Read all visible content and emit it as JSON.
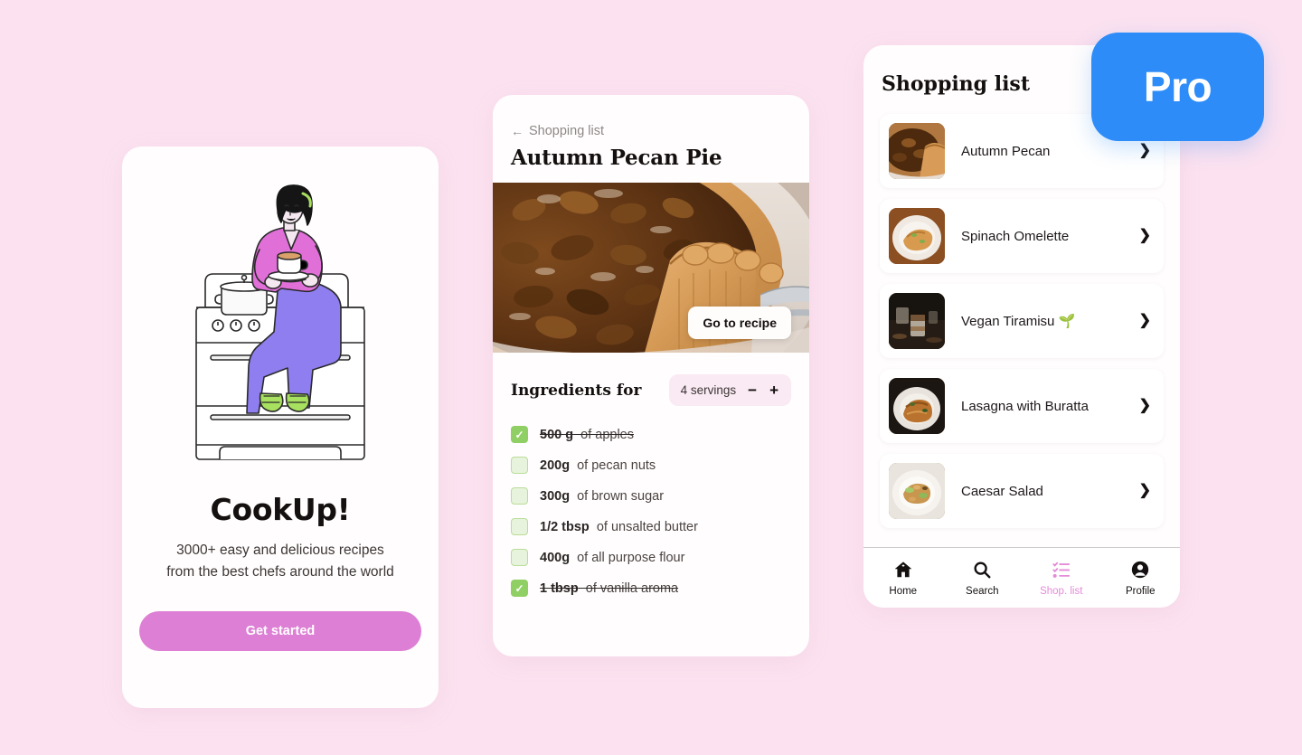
{
  "theme": {
    "background": "#fce2f0",
    "card_bg": "#fffdfd",
    "accent_pink": "#dd7fd4",
    "accent_blue": "#2d8cf8",
    "check_green": "#8fcf64",
    "nav_active": "#e48bd8"
  },
  "onboarding": {
    "illustration_name": "woman-sitting-on-stove-illustration",
    "title": "CookUp!",
    "subtitle_line1": "3000+ easy and delicious recipes",
    "subtitle_line2": "from the best chefs around the world",
    "cta_label": "Get started"
  },
  "recipe": {
    "back_label": "Shopping list",
    "back_icon": "arrow-left-icon",
    "title": "Autumn Pecan Pie",
    "hero_image_name": "pecan-pie-photo",
    "hero_button_label": "Go to recipe",
    "ingredients_heading": "Ingredients for",
    "servings": {
      "value": "4 servings",
      "decrement_label": "−",
      "increment_label": "+"
    },
    "ingredients": [
      {
        "qty": "500 g",
        "name": "of apples",
        "checked": true
      },
      {
        "qty": "200g",
        "name": "of pecan nuts",
        "checked": false
      },
      {
        "qty": "300g",
        "name": "of brown sugar",
        "checked": false
      },
      {
        "qty": "1/2 tbsp",
        "name": "of unsalted butter",
        "checked": false
      },
      {
        "qty": "400g",
        "name": "of all purpose flour",
        "checked": false
      },
      {
        "qty": "1 tbsp",
        "name": "of vanilla aroma",
        "checked": true
      }
    ]
  },
  "shopping": {
    "title": "Shopping list",
    "chevron_icon": "chevron-right-icon",
    "items": [
      {
        "name": "Autumn Pecan",
        "thumb": "pecan-pie-thumb"
      },
      {
        "name": "Spinach Omelette",
        "thumb": "omelette-thumb"
      },
      {
        "name": "Vegan Tiramisu 🌱",
        "thumb": "tiramisu-thumb"
      },
      {
        "name": "Lasagna with Buratta",
        "thumb": "lasagna-thumb"
      },
      {
        "name": "Caesar Salad",
        "thumb": "salad-thumb"
      }
    ],
    "tabs": [
      {
        "label": "Home",
        "icon": "home-icon",
        "active": false
      },
      {
        "label": "Search",
        "icon": "search-icon",
        "active": false
      },
      {
        "label": "Shop. list",
        "icon": "checklist-icon",
        "active": true
      },
      {
        "label": "Profile",
        "icon": "profile-icon",
        "active": false
      }
    ]
  },
  "pro_badge": {
    "label": "Pro"
  }
}
